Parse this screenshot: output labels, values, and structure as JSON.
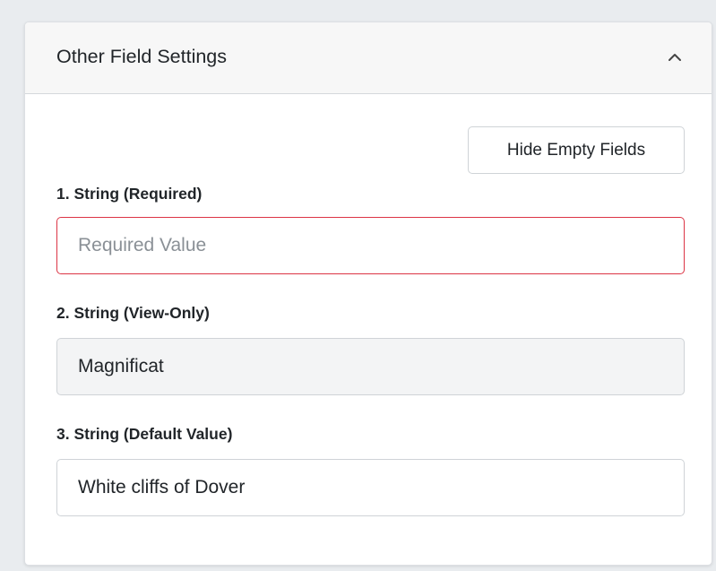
{
  "panel": {
    "title": "Other Field Settings",
    "collapse_icon": "chevron-up-icon"
  },
  "toolbar": {
    "hide_empty_label": "Hide Empty Fields"
  },
  "fields": [
    {
      "label": "1. String (Required)",
      "value": "",
      "placeholder": "Required Value",
      "state": "invalid"
    },
    {
      "label": "2. String (View-Only)",
      "value": "Magnificat",
      "placeholder": "",
      "state": "readonly"
    },
    {
      "label": "3. String (Default Value)",
      "value": "White cliffs of Dover",
      "placeholder": "",
      "state": "default"
    }
  ],
  "colors": {
    "invalid_border": "#dc3545",
    "readonly_bg": "#f3f4f5",
    "header_bg": "#f7f7f7"
  }
}
